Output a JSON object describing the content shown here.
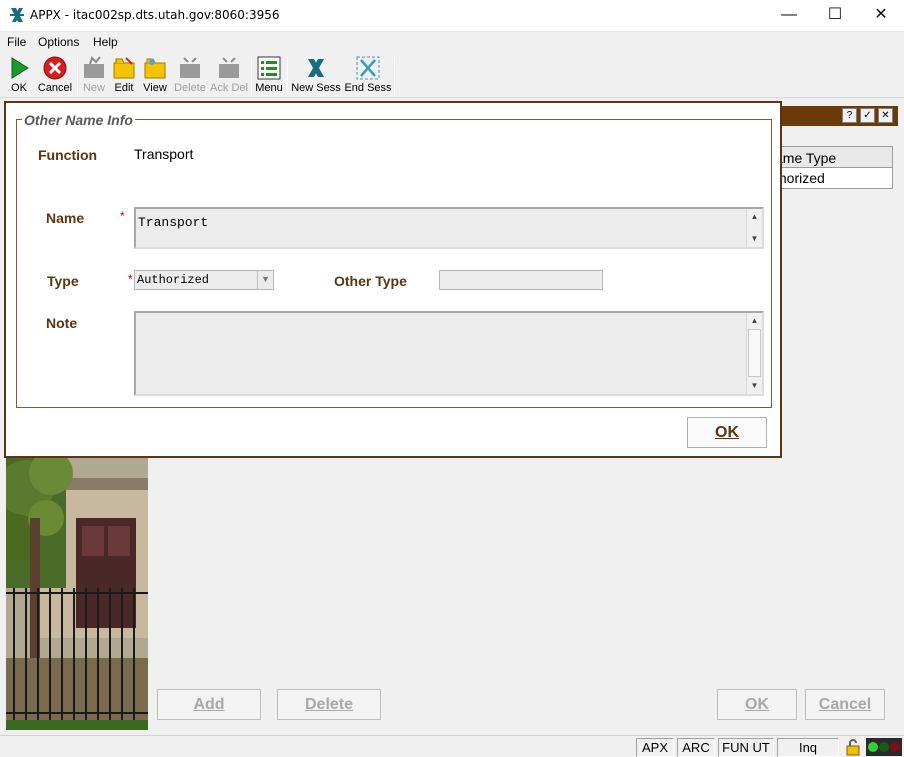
{
  "window": {
    "title": "APPX - itac002sp.dts.utah.gov:8060:3956",
    "minimize": "—",
    "maximize": "☐",
    "close": "✕"
  },
  "menu": {
    "items": [
      "File",
      "Options",
      "Help"
    ]
  },
  "toolbar": {
    "ok": "OK",
    "cancel": "Cancel",
    "new": "New",
    "edit": "Edit",
    "view": "View",
    "delete": "Delete",
    "ack_del": "Ack Del",
    "menu": "Menu",
    "new_sess": "New Sess",
    "end_sess": "End Sess"
  },
  "background": {
    "header_buttons": [
      "?",
      "✓",
      "✕"
    ],
    "table": {
      "header": "ame Type",
      "rows": [
        "thorized"
      ]
    },
    "buttons": {
      "add": "Add",
      "delete": "Delete",
      "ok": "OK",
      "cancel": "Cancel"
    }
  },
  "dialog": {
    "group_title": "Other Name Info",
    "function_label": "Function",
    "function_value": "Transport",
    "name_label": "Name",
    "name_value": "Transport",
    "required_marker": "*",
    "type_label": "Type",
    "type_value": "Authorized",
    "other_type_label": "Other Type",
    "other_type_value": "",
    "note_label": "Note",
    "note_value": "",
    "ok_label": "OK"
  },
  "statusbar": {
    "items": [
      "APX",
      "ARC",
      "FUN UT",
      "Inq"
    ]
  },
  "colors": {
    "dialog_border": "#5a3612",
    "label_brown": "#5a3612",
    "header_brown": "#6b3a08",
    "required_red": "#cc0000"
  }
}
